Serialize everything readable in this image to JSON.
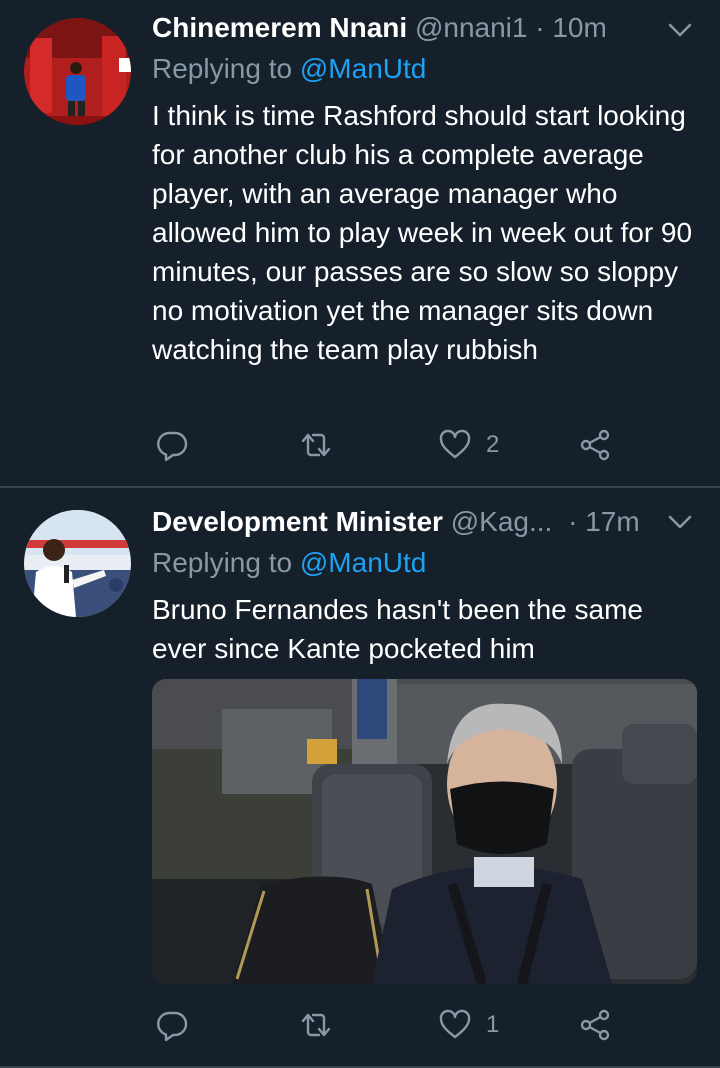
{
  "tweets": [
    {
      "name": "Chinemerem Nnani",
      "handle": "@nnani1",
      "time": "· 10m",
      "replying_prefix": "Replying to",
      "replying_mention": "@ManUtd",
      "text": "I think is time Rashford should start looking for another club his a complete average player, with an average manager who allowed him to play week in week out for 90 minutes, our passes are so slow so sloppy no motivation yet the manager sits down watching the team play rubbish",
      "likes": "2"
    },
    {
      "name": "Development Minister",
      "handle": "@Kag...",
      "time": "· 17m",
      "replying_prefix": "Replying to",
      "replying_mention": "@ManUtd",
      "text": "Bruno Fernandes hasn't been the same ever since Kante pocketed him",
      "likes": "1"
    }
  ],
  "colors": {
    "background": "#15202b",
    "secondary_text": "#8899a6",
    "link": "#1da1f2",
    "divider": "#38444d"
  },
  "icons": [
    "reply-icon",
    "retweet-icon",
    "like-icon",
    "share-icon",
    "chevron-down-icon"
  ]
}
